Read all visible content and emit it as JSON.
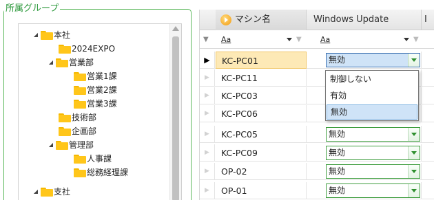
{
  "group": {
    "title": "所属グループ",
    "tree": [
      {
        "label": "本社",
        "expanded": true
      },
      {
        "label": "2024EXPO"
      },
      {
        "label": "営業部",
        "expanded": true
      },
      {
        "label": "営業1課"
      },
      {
        "label": "営業2課"
      },
      {
        "label": "営業3課"
      },
      {
        "label": "技術部"
      },
      {
        "label": "企画部"
      },
      {
        "label": "管理部",
        "expanded": true
      },
      {
        "label": "人事課"
      },
      {
        "label": "総務経理課"
      },
      {
        "label": "支社",
        "expanded": true
      }
    ]
  },
  "grid": {
    "columns": {
      "name": "マシン名",
      "wu": "Windows Update",
      "extra": "I"
    },
    "filter": {
      "name_text": "Aa",
      "wu_text": "Aa"
    },
    "rows": [
      {
        "machine": "KC-PC01",
        "wu": "無効",
        "selected": true
      },
      {
        "machine": "KC-PC11",
        "wu": ""
      },
      {
        "machine": "KC-PC03",
        "wu": ""
      },
      {
        "machine": "KC-PC06",
        "wu": ""
      },
      {
        "machine": "KC-PC05",
        "wu": "無効"
      },
      {
        "machine": "KC-PC09",
        "wu": "無効"
      },
      {
        "machine": "OP-02",
        "wu": "無効"
      },
      {
        "machine": "OP-01",
        "wu": "無効"
      }
    ],
    "dropdown": {
      "options": [
        "制御しない",
        "有効",
        "無効"
      ],
      "selected": "無効"
    }
  },
  "colors": {
    "accent_green": "#2f9a3e",
    "selection": "#fde9b6",
    "highlight": "#cfe3f7"
  }
}
